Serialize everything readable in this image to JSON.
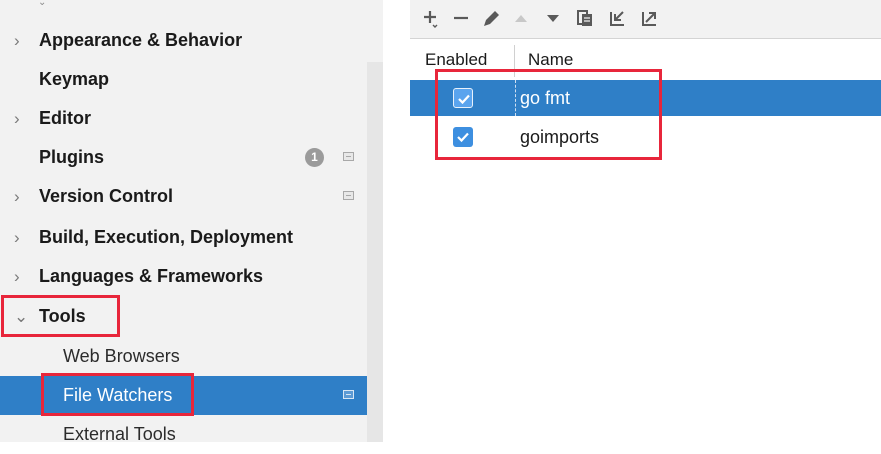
{
  "sidebar": {
    "items": [
      {
        "label": "Appearance & Behavior",
        "chevron": "›"
      },
      {
        "label": "Keymap"
      },
      {
        "label": "Editor",
        "chevron": "›"
      },
      {
        "label": "Plugins",
        "badge": "1"
      },
      {
        "label": "Version Control",
        "chevron": "›"
      },
      {
        "label": "Build, Execution, Deployment",
        "chevron": "›"
      },
      {
        "label": "Languages & Frameworks",
        "chevron": "›"
      },
      {
        "label": "Tools",
        "chevron": "⌄"
      },
      {
        "label": "Web Browsers"
      },
      {
        "label": "File Watchers"
      },
      {
        "label": "External Tools"
      }
    ]
  },
  "toolbar": {
    "icons": [
      "add-icon",
      "remove-icon",
      "edit-icon",
      "move-up-icon",
      "move-down-icon",
      "copy-icon",
      "import-icon",
      "export-icon"
    ]
  },
  "table": {
    "headers": {
      "enabled": "Enabled",
      "name": "Name"
    },
    "rows": [
      {
        "name": "go fmt",
        "enabled": true,
        "selected": true
      },
      {
        "name": "goimports",
        "enabled": true,
        "selected": false
      }
    ]
  },
  "colors": {
    "selection": "#2f7fc7",
    "checkbox": "#3d8fe0",
    "highlight": "#e8263b"
  }
}
